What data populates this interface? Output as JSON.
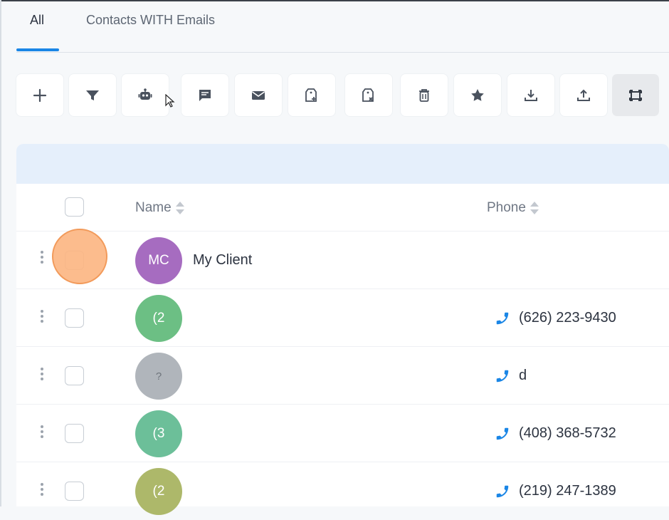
{
  "tabs": [
    {
      "label": "All",
      "active": true
    },
    {
      "label": "Contacts WITH Emails",
      "active": false
    }
  ],
  "toolbar": [
    {
      "icon": "plus-icon"
    },
    {
      "icon": "filter-icon"
    },
    {
      "icon": "robot-icon"
    },
    {
      "icon": "chat-icon"
    },
    {
      "icon": "mail-icon"
    },
    {
      "icon": "tag-add-icon"
    },
    {
      "icon": "tag-remove-icon"
    },
    {
      "icon": "trash-icon"
    },
    {
      "icon": "star-icon"
    },
    {
      "icon": "download-icon"
    },
    {
      "icon": "upload-icon"
    },
    {
      "icon": "expand-icon",
      "active": true
    }
  ],
  "table": {
    "columns": {
      "name": "Name",
      "phone": "Phone"
    },
    "rows": [
      {
        "initials": "MC",
        "name": "My Client",
        "phone": "",
        "avatar_color": "#a66cc0"
      },
      {
        "initials": "(2",
        "name": "",
        "phone": "(626) 223-9430",
        "avatar_color": "#6cbf84"
      },
      {
        "initials": "?",
        "name": "",
        "phone": "d",
        "avatar_color": "#b0b5bb"
      },
      {
        "initials": "(3",
        "name": "",
        "phone": "(408) 368-5732",
        "avatar_color": "#6cbf99"
      },
      {
        "initials": "(2",
        "name": "",
        "phone": "(219) 247-1389",
        "avatar_color": "#adb86a"
      }
    ]
  },
  "colors": {
    "accent": "#1a86e6",
    "banner": "#e5effb",
    "highlight": "#fcb581"
  }
}
